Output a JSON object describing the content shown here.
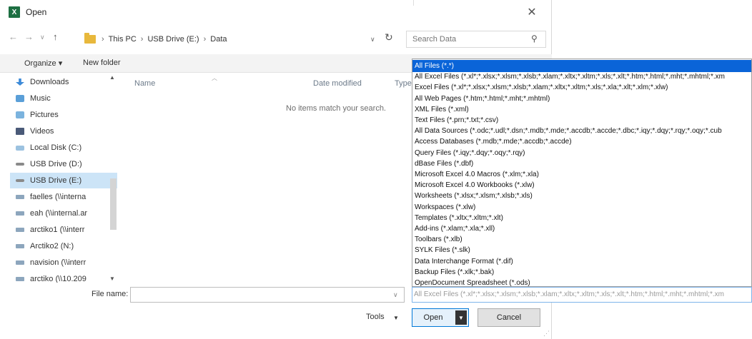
{
  "window": {
    "title": "Open",
    "app_icon": "X"
  },
  "nav": {
    "breadcrumb": [
      "This PC",
      "USB Drive (E:)",
      "Data"
    ],
    "search_placeholder": "Search Data"
  },
  "toolbar": {
    "organize_label": "Organize ▾",
    "new_folder_label": "New folder"
  },
  "sidebar": {
    "items": [
      {
        "label": "Downloads",
        "icon": "download-icon"
      },
      {
        "label": "Music",
        "icon": "music-icon"
      },
      {
        "label": "Pictures",
        "icon": "pictures-icon"
      },
      {
        "label": "Videos",
        "icon": "videos-icon"
      },
      {
        "label": "Local Disk (C:)",
        "icon": "disk-icon"
      },
      {
        "label": "USB Drive (D:)",
        "icon": "usb-icon"
      },
      {
        "label": "USB Drive (E:)",
        "icon": "usb-icon",
        "selected": true
      },
      {
        "label": "faelles (\\\\interna",
        "icon": "network-drive-icon"
      },
      {
        "label": "eah (\\\\internal.ar",
        "icon": "network-drive-icon"
      },
      {
        "label": "arctiko1 (\\\\interr",
        "icon": "network-drive-icon"
      },
      {
        "label": "Arctiko2 (N:)",
        "icon": "network-drive-icon"
      },
      {
        "label": "navision (\\\\interr",
        "icon": "network-drive-icon"
      },
      {
        "label": "arctiko (\\\\10.209",
        "icon": "network-drive-icon"
      }
    ]
  },
  "filelist": {
    "columns": [
      "Name",
      "Date modified",
      "Type"
    ],
    "empty_message": "No items match your search."
  },
  "footer": {
    "filename_label": "File name:",
    "filename_value": "",
    "filter_value": "All Excel Files (*.xl*;*.xlsx;*.xlsm;*.xlsb;*.xlam;*.xltx;*.xltm;*.xls;*.xlt;*.htm;*.html;*.mht;*.mhtml;*.xm",
    "tools_label": "Tools",
    "open_label": "Open",
    "cancel_label": "Cancel"
  },
  "filter_options": [
    "All Files (*.*)",
    "All Excel Files (*.xl*;*.xlsx;*.xlsm;*.xlsb;*.xlam;*.xltx;*.xltm;*.xls;*.xlt;*.htm;*.html;*.mht;*.mhtml;*.xm",
    "Excel Files (*.xl*;*.xlsx;*.xlsm;*.xlsb;*.xlam;*.xltx;*.xltm;*.xls;*.xla;*.xlt;*.xlm;*.xlw)",
    "All Web Pages (*.htm;*.html;*.mht;*.mhtml)",
    "XML Files (*.xml)",
    "Text Files (*.prn;*.txt;*.csv)",
    "All Data Sources (*.odc;*.udl;*.dsn;*.mdb;*.mde;*.accdb;*.accde;*.dbc;*.iqy;*.dqy;*.rqy;*.oqy;*.cub",
    "Access Databases (*.mdb;*.mde;*.accdb;*.accde)",
    "Query Files (*.iqy;*.dqy;*.oqy;*.rqy)",
    "dBase Files (*.dbf)",
    "Microsoft Excel 4.0 Macros (*.xlm;*.xla)",
    "Microsoft Excel 4.0 Workbooks (*.xlw)",
    "Worksheets (*.xlsx;*.xlsm;*.xlsb;*.xls)",
    "Workspaces (*.xlw)",
    "Templates (*.xltx;*.xltm;*.xlt)",
    "Add-ins (*.xlam;*.xla;*.xll)",
    "Toolbars (*.xlb)",
    "SYLK Files (*.slk)",
    "Data Interchange Format (*.dif)",
    "Backup Files (*.xlk;*.bak)",
    "OpenDocument Spreadsheet (*.ods)"
  ],
  "selected_filter_index": 0,
  "colors": {
    "selection": "#0a64d8",
    "nav_selected": "#cce4f7",
    "accent": "#0078d7"
  }
}
